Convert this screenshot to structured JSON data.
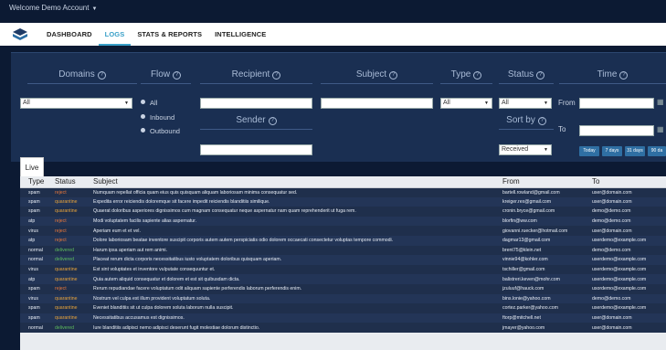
{
  "topbar": {
    "welcome": "Welcome Demo Account"
  },
  "nav": {
    "tabs": [
      "DASHBOARD",
      "LOGS",
      "STATS & REPORTS",
      "INTELLIGENCE"
    ],
    "active": "LOGS"
  },
  "filters": {
    "headers": {
      "domains": "Domains",
      "flow": "Flow",
      "recipient": "Recipient",
      "subject": "Subject",
      "type": "Type",
      "status": "Status",
      "time": "Time",
      "sender": "Sender",
      "sortby": "Sort by"
    },
    "help_glyph": "?",
    "domains_value": "All",
    "flow_options": [
      "All",
      "Inbound",
      "Outbound"
    ],
    "type_value": "All",
    "status_value": "All",
    "sort_value": "Received",
    "from_label": "From",
    "to_label": "To",
    "time_buttons": [
      "Today",
      "7 days",
      "31 days",
      "90 da"
    ]
  },
  "live_tab": "Live",
  "table": {
    "columns": [
      "Type",
      "Status",
      "Subject",
      "From",
      "To"
    ],
    "rows": [
      [
        "spam",
        "reject",
        "Numquam repellat officia quam eius quis quisquam aliquam laboriosam minima consequatur sed.",
        "bartell.rowland@gmail.com",
        "user@domain.com"
      ],
      [
        "spam",
        "quarantine",
        "Expedita error reiciendis doloremque sit facere impedit reiciendis blanditiis similique.",
        "kreiger.rex@gmail.com",
        "user@domain.com"
      ],
      [
        "spam",
        "quarantine",
        "Quaerat doloribus asperiores dignissimos cum magnam consequatur neque aspernatur nam quam reprehenderit ut fuga rem.",
        "cronin.bryce@gmail.com",
        "demo@demo.com"
      ],
      [
        "atp",
        "reject",
        "Modi voluptatem facilis sapiente alias aspernatur.",
        "blorfin@ww.com",
        "demo@demo.com"
      ],
      [
        "virus",
        "reject",
        "Aperiam eum et et vel.",
        "giovanni.ruecker@hotmail.com",
        "user@domain.com"
      ],
      [
        "atp",
        "reject",
        "Dolore laboriosam beatae inventore suscipit corporis autem autem perspiciatis odio dolorem occaecati consectetur voluptas tempore commodi.",
        "dagmar13@gmail.com",
        "userdemo@example.com"
      ],
      [
        "normal",
        "delivered",
        "Harum ipsa aperiam aut rem animi.",
        "brent75@klein.net",
        "demo@demo.com"
      ],
      [
        "normal",
        "delivered",
        "Placeat rerum dicta corporis necessitatibus iusto voluptatem doloribus quisquam aperiam.",
        "vinnie94@kohler.com",
        "userdemo@example.com"
      ],
      [
        "virus",
        "quarantine",
        "Est sint voluptates et inventore vulputate consequuntur et.",
        "tschiller@gmail.com",
        "userdemo@example.com"
      ],
      [
        "atp",
        "quarantine",
        "Quia autem aliquid consequatur et dolorem et est sit quibusdam dicta.",
        "balistreri.keven@mohr.com",
        "userdemo@example.com"
      ],
      [
        "spam",
        "reject",
        "Rerum repudiandae facere voluptatum odit aliquam sapiente perferendis laborum perferendis enim.",
        "jzuluuf@hauck.com",
        "usordemo@example.com"
      ],
      [
        "virus",
        "quarantine",
        "Nostrum vel culpa est illum provident voluptatum soluta.",
        "bins.lonie@yahoo.com",
        "demo@demo.com"
      ],
      [
        "spam",
        "quarantine",
        "Eveniet blanditiis sit ut culpa dolorem soluta laborum nulla suscipit.",
        "cortez.parker@yahoo.com",
        "userdemo@example.com"
      ],
      [
        "spam",
        "quarantine",
        "Necessitatibus accusamus est dignissimos.",
        "ftorp@mitchell.net",
        "user@domain.com"
      ],
      [
        "normal",
        "delivered",
        "Iure blanditiis adipisci nemo adipisci deserunt fugit molestiae dolorum distinctio.",
        "jmayer@yahoo.com",
        "user@domain.com"
      ]
    ]
  }
}
